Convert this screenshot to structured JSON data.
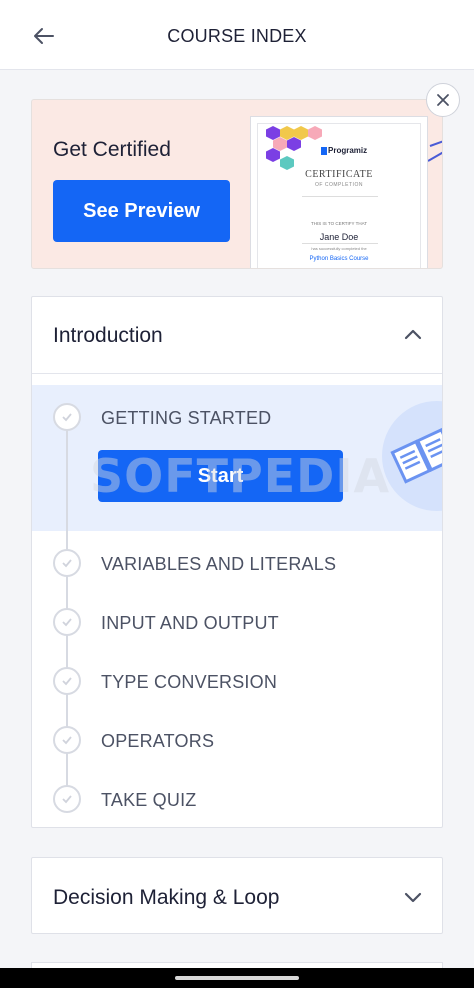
{
  "header": {
    "title": "COURSE INDEX",
    "back_icon": "arrow-left-icon"
  },
  "promo": {
    "title": "Get Certified",
    "button_label": "See Preview",
    "close_icon": "close-icon",
    "certificate": {
      "brand": "Programiz",
      "heading": "CERTIFICATE",
      "subheading": "OF COMPLETION",
      "certify_text": "THIS IS TO CERTIFY THAT",
      "name": "Jane Doe",
      "completed_text": "has successfully completed the",
      "course": "Python Basics Course"
    }
  },
  "sections": [
    {
      "title": "Introduction",
      "expanded": true,
      "chevron_icon": "chevron-up-icon",
      "lessons": [
        {
          "label": "GETTING STARTED",
          "active": true
        },
        {
          "label": "VARIABLES AND LITERALS"
        },
        {
          "label": "INPUT AND OUTPUT"
        },
        {
          "label": "TYPE CONVERSION"
        },
        {
          "label": "OPERATORS"
        },
        {
          "label": "TAKE QUIZ"
        }
      ],
      "start_label": "Start"
    },
    {
      "title": "Decision Making & Loop",
      "expanded": false,
      "chevron_icon": "chevron-down-icon"
    }
  ],
  "watermark": "SOFTPEDIA",
  "colors": {
    "accent": "#1466f5",
    "promo_bg": "#fbe9e4",
    "active_lesson_bg": "#e8effd",
    "text": "#1e2136"
  }
}
